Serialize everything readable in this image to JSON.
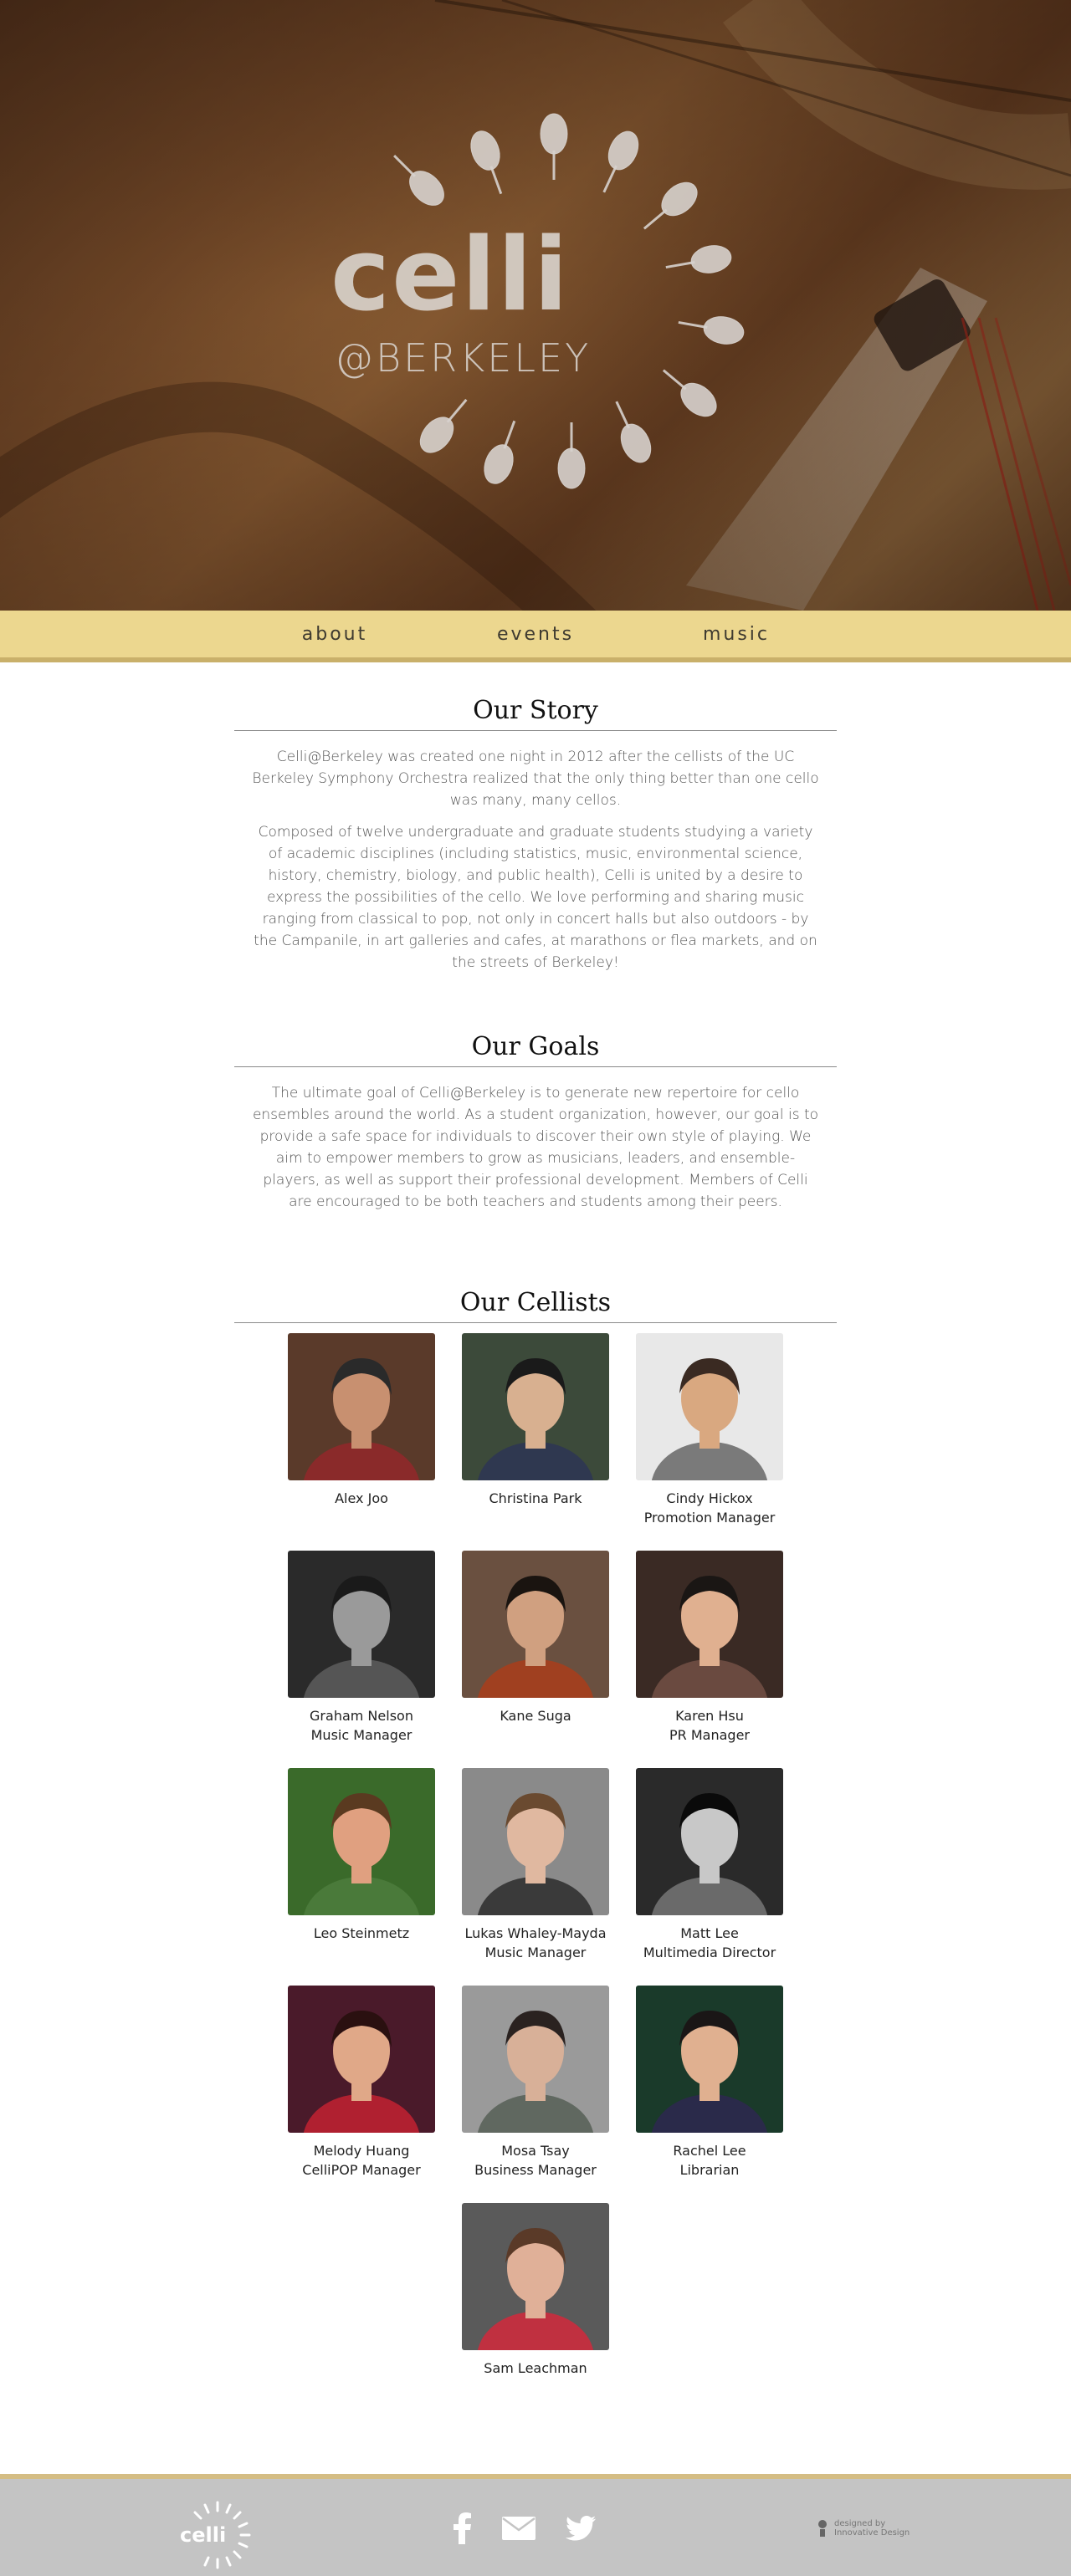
{
  "hero": {
    "logo_word": "celli",
    "logo_sub": "@BERKELEY"
  },
  "nav": {
    "items": [
      "about",
      "events",
      "music"
    ]
  },
  "story": {
    "title": "Our Story",
    "paragraphs": [
      "Celli@Berkeley was created one night in 2012 after the cellists of the UC Berkeley Symphony Orchestra realized that the only thing better than one cello was many, many cellos.",
      "Composed of twelve undergraduate and graduate students studying a variety of academic disciplines (including statistics, music, environmental science, history, chemistry, biology, and public health), Celli is united by a desire to express the possibilities of the cello. We love performing and sharing music ranging from classical to pop, not only in concert halls but also outdoors - by the Campanile, in art galleries and cafes, at marathons or flea markets, and on the streets of Berkeley!"
    ]
  },
  "goals": {
    "title": "Our Goals",
    "paragraph": "The ultimate goal of Celli@Berkeley is to generate new repertoire for cello ensembles around the world. As a student organization, however, our goal is to provide a safe space for individuals to discover their own style of playing. We aim to empower members to grow as musicians, leaders, and ensemble-players, as well as support their professional development. Members of Celli are encouraged to be both teachers and students among their peers."
  },
  "cellists": {
    "title": "Our Cellists",
    "members": [
      {
        "name": "Alex Joo",
        "role": ""
      },
      {
        "name": "Christina Park",
        "role": ""
      },
      {
        "name": "Cindy Hickox",
        "role": "Promotion Manager"
      },
      {
        "name": "Graham Nelson",
        "role": "Music Manager"
      },
      {
        "name": "Kane Suga",
        "role": ""
      },
      {
        "name": "Karen Hsu",
        "role": "PR Manager"
      },
      {
        "name": "Leo Steinmetz",
        "role": ""
      },
      {
        "name": "Lukas Whaley-Mayda",
        "role": "Music Manager"
      },
      {
        "name": "Matt Lee",
        "role": "Multimedia Director"
      },
      {
        "name": "Melody Huang",
        "role": "CelliPOP Manager"
      },
      {
        "name": "Mosa Tsay",
        "role": "Business Manager"
      },
      {
        "name": "Rachel Lee",
        "role": "Librarian"
      },
      {
        "name": "Sam Leachman",
        "role": ""
      }
    ]
  },
  "footer": {
    "logo_word": "celli",
    "icons": [
      "facebook-icon",
      "mail-icon",
      "twitter-icon"
    ],
    "credit_line1": "designed by",
    "credit_line2": "Innovative Design"
  }
}
